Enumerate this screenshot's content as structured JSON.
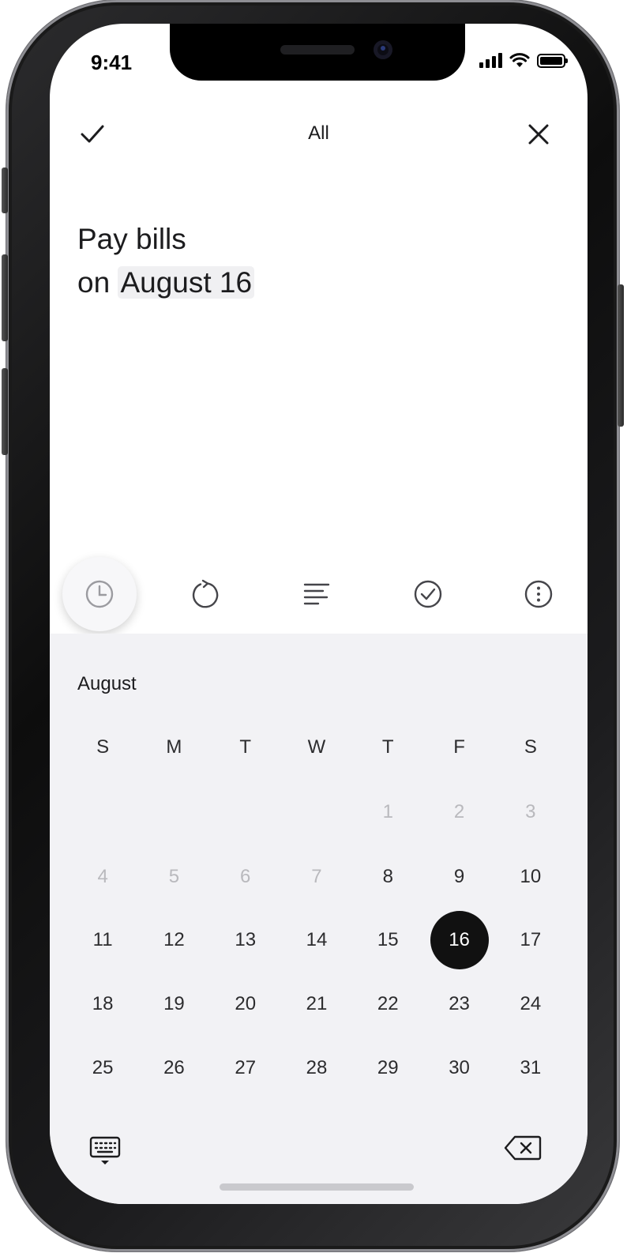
{
  "status_bar": {
    "time": "9:41"
  },
  "header": {
    "list_name": "All"
  },
  "task": {
    "title": "Pay bills",
    "date_prefix": "on",
    "date_text": "August 16"
  },
  "toolbar": {
    "items": [
      "clock-icon",
      "repeat-icon",
      "notes-icon",
      "checkmark-circle-icon",
      "more-icon"
    ],
    "active": "clock-icon"
  },
  "calendar": {
    "month": "August",
    "weekdays": [
      "S",
      "M",
      "T",
      "W",
      "T",
      "F",
      "S"
    ],
    "weeks": [
      [
        "",
        "",
        "",
        "",
        "1",
        "2",
        "3"
      ],
      [
        "4",
        "5",
        "6",
        "7",
        "8",
        "9",
        "10"
      ],
      [
        "11",
        "12",
        "13",
        "14",
        "15",
        "16",
        "17"
      ],
      [
        "18",
        "19",
        "20",
        "21",
        "22",
        "23",
        "24"
      ],
      [
        "25",
        "26",
        "27",
        "28",
        "29",
        "30",
        "31"
      ]
    ],
    "disabled_days": [
      "1",
      "2",
      "3",
      "4",
      "5",
      "6",
      "7"
    ],
    "selected_day": "16"
  },
  "colors": {
    "selected_day_bg": "#111111",
    "calendar_bg": "#f2f2f5",
    "disabled_text": "#b9b9bd"
  }
}
